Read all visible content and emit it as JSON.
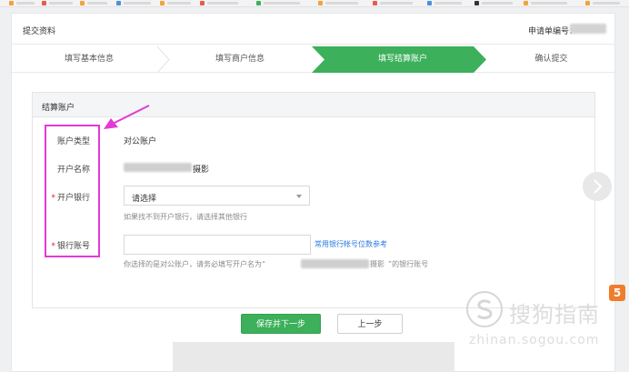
{
  "header": {
    "title": "提交资料",
    "order_label": "申请单编号："
  },
  "steps": [
    {
      "label": "填写基本信息",
      "active": false
    },
    {
      "label": "填写商户信息",
      "active": false
    },
    {
      "label": "填写结算账户",
      "active": true
    },
    {
      "label": "确认提交",
      "active": false
    }
  ],
  "section": {
    "title": "结算账户",
    "account_type_label": "账户类型",
    "account_type_value": "对公账户",
    "account_name_label": "开户名称",
    "account_name_suffix": "摄影",
    "bank_label": "开户银行",
    "bank_placeholder": "请选择",
    "bank_hint": "如果找不到开户银行，请选择其他银行",
    "account_no_label": "银行账号",
    "account_no_link": "常用银行帐号位数参考",
    "account_no_hint_prefix": "你选择的是对公账户，请务必填写开户名为“",
    "account_no_hint_name": "摄影",
    "account_no_hint_suffix": "”的银行账号",
    "required_mark": "*"
  },
  "buttons": {
    "save_next": "保存并下一步",
    "prev": "上一步"
  },
  "watermark": {
    "text": "搜狗指南",
    "url": "zhinan.sogou.com",
    "badge": "5"
  },
  "colors": {
    "accent_green": "#3cb05a",
    "annotation_magenta": "#e33ad6",
    "link_blue": "#2a7ae2",
    "required_red": "#e02020"
  }
}
